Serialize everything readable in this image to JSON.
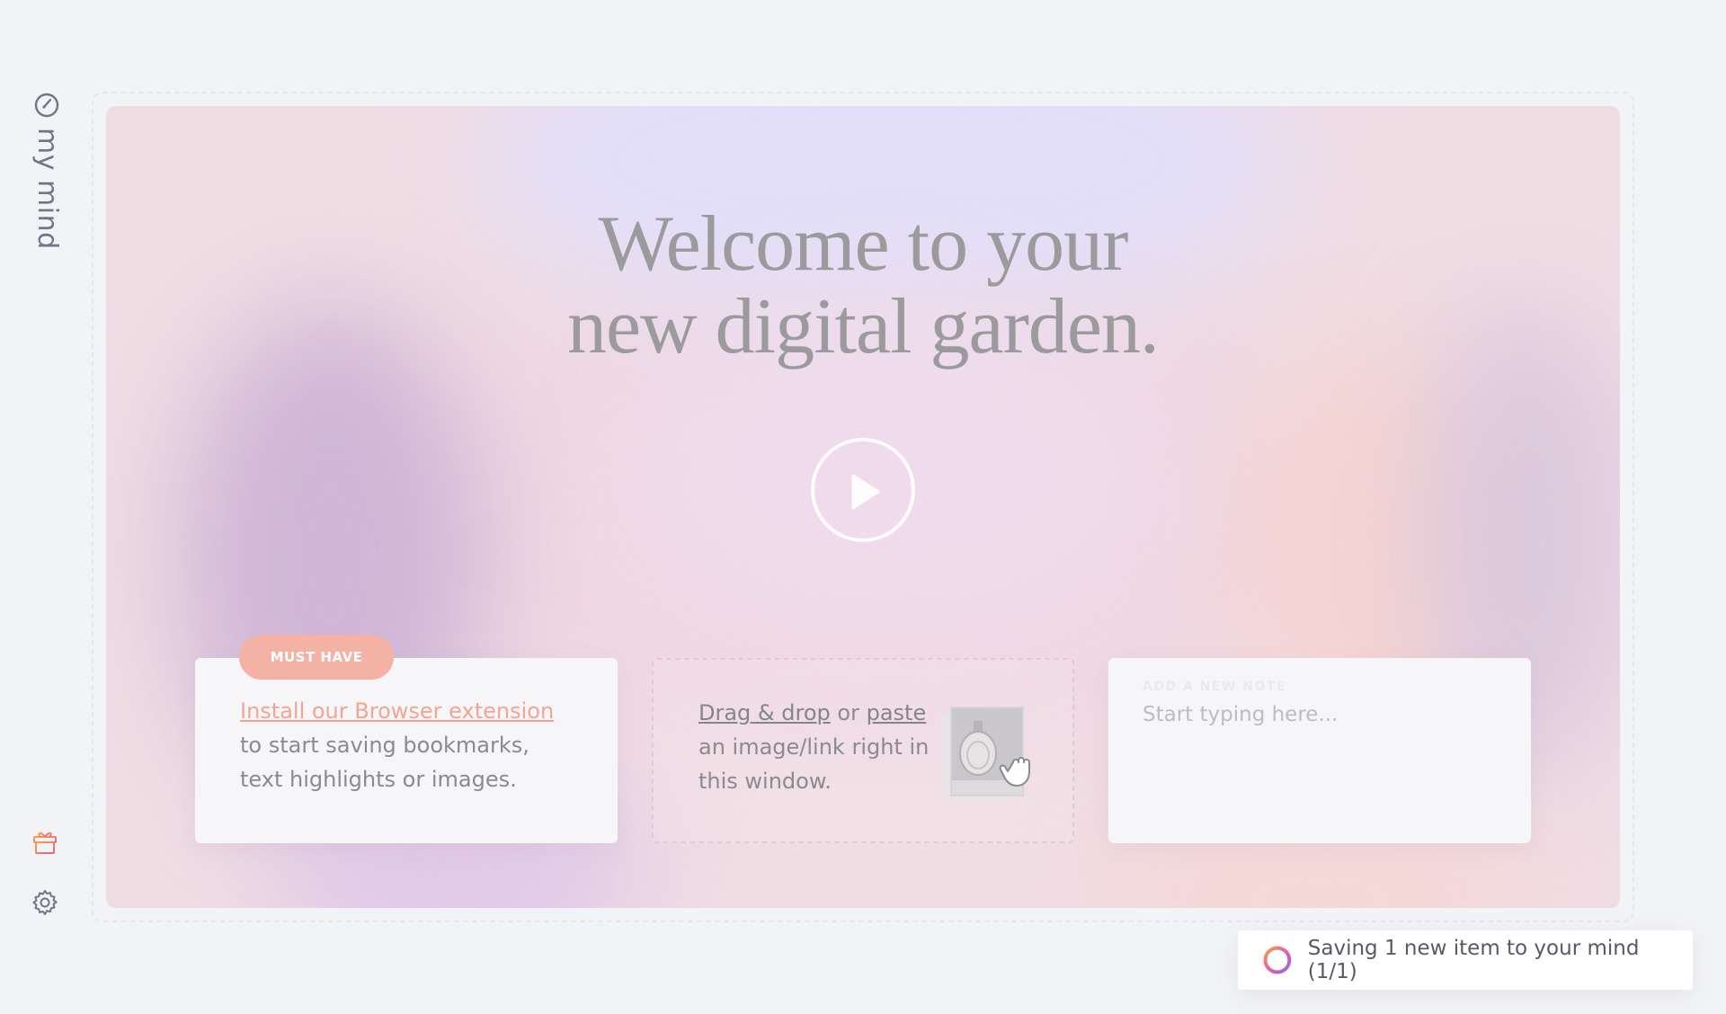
{
  "sidebar": {
    "brand": "my mind",
    "icons": {
      "logo": "gauge-icon",
      "gift": "gift-icon",
      "settings": "gear-icon"
    }
  },
  "hero": {
    "headline_line1": "Welcome to your",
    "headline_line2": "new digital garden.",
    "play_icon": "play-icon"
  },
  "cards": {
    "install": {
      "badge": "MUST HAVE",
      "link": "Install our Browser extension",
      "description": "to start saving bookmarks, text highlights or images."
    },
    "drop": {
      "link_drag": "Drag & drop",
      "or": "or",
      "link_paste": "paste",
      "description": "an image/link right in this window."
    },
    "note": {
      "label": "ADD A NEW NOTE",
      "placeholder": "Start typing here..."
    }
  },
  "toast": {
    "message": "Saving 1 new item to your mind (1/1)"
  },
  "colors": {
    "accent_orange": "#f4b2a4",
    "link_orange": "#f1a693",
    "background": "#f2f3f6"
  }
}
